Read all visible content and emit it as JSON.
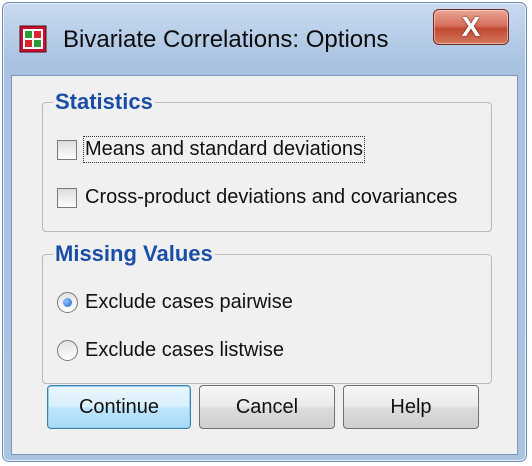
{
  "window": {
    "title": "Bivariate Correlations: Options",
    "close_symbol": "X",
    "icon": "spss-dialog-icon",
    "close_color": "#c24a33",
    "accent_color": "#1a4ea6"
  },
  "statistics": {
    "title": "Statistics",
    "options": [
      {
        "label": "Means and standard deviations",
        "checked": false
      },
      {
        "label": "Cross-product deviations and covariances",
        "checked": false
      }
    ]
  },
  "missing_values": {
    "title": "Missing Values",
    "options": [
      {
        "label": "Exclude cases pairwise",
        "selected": true
      },
      {
        "label": "Exclude cases listwise",
        "selected": false
      }
    ]
  },
  "buttons": {
    "continue": "Continue",
    "cancel": "Cancel",
    "help": "Help"
  }
}
